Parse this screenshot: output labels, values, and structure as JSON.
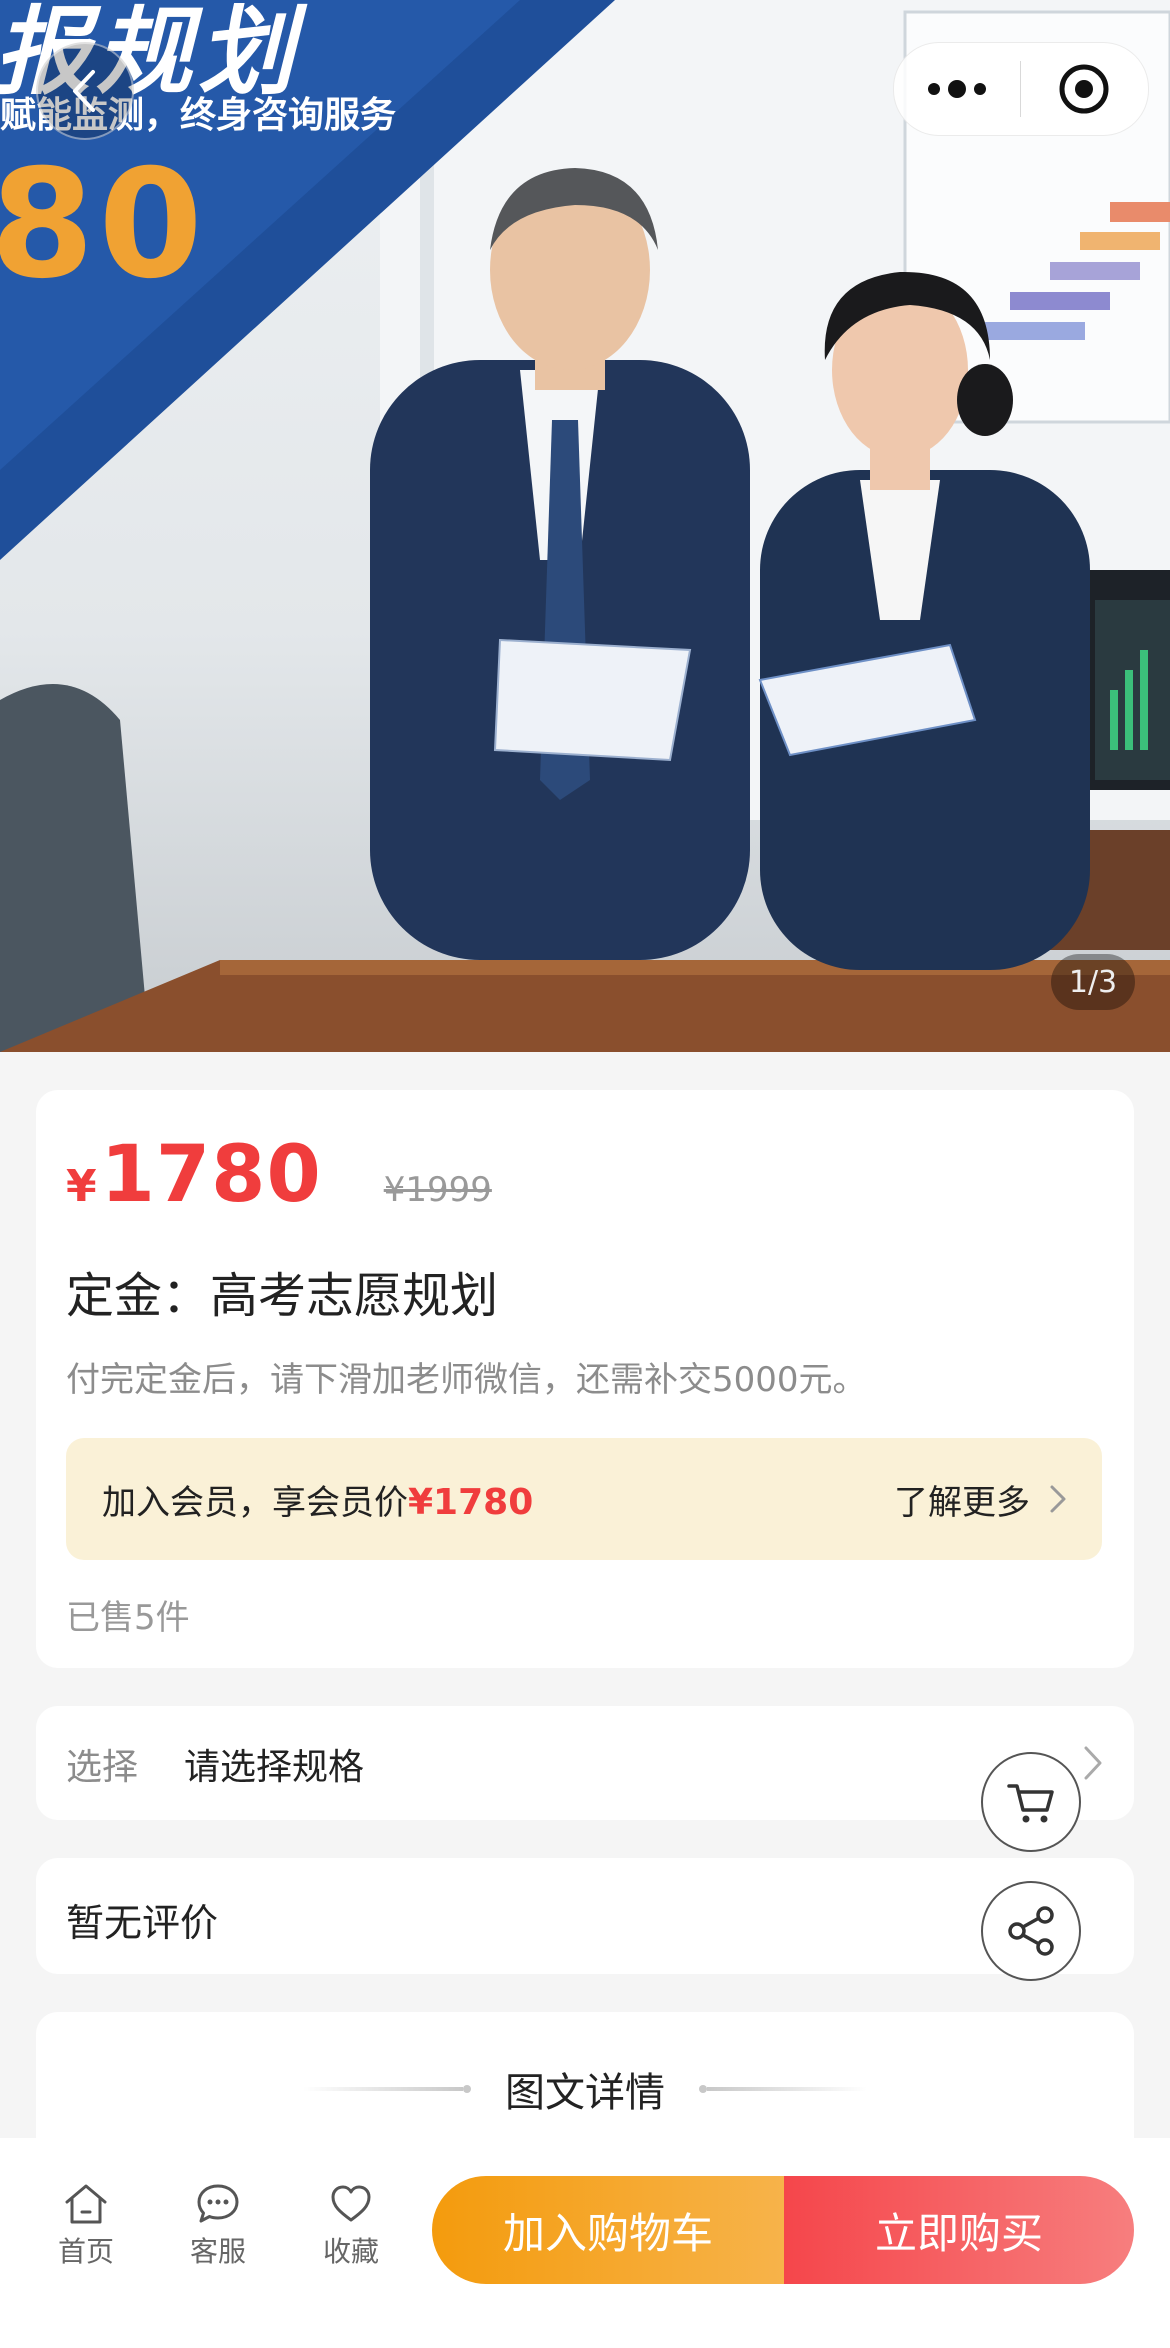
{
  "hero": {
    "title": "报规划",
    "subtitle": "赋能监测，终身咨询服务",
    "number": "80",
    "image_counter": "1/3"
  },
  "price": {
    "symbol": "¥",
    "current": "1780",
    "original": "¥1999"
  },
  "product": {
    "title": "定金：高考志愿规划",
    "description": "付完定金后，请下滑加老师微信，还需补交5000元。"
  },
  "member": {
    "text": "加入会员，享会员价",
    "price": "¥1780",
    "more": "了解更多"
  },
  "sold": "已售5件",
  "spec": {
    "label": "选择",
    "value": "请选择规格"
  },
  "review": {
    "text": "暂无评价"
  },
  "detail": {
    "title": "图文详情"
  },
  "bottom_nav": {
    "home": "首页",
    "service": "客服",
    "favorite": "收藏",
    "add_to_cart": "加入购物车",
    "buy_now": "立即购买"
  },
  "colors": {
    "price_red": "#f03d3d",
    "member_bg": "#faf1d7",
    "cart_orange": "#f49b0d",
    "buy_red": "#f5464b",
    "hero_blue": "#1f4f9a"
  }
}
